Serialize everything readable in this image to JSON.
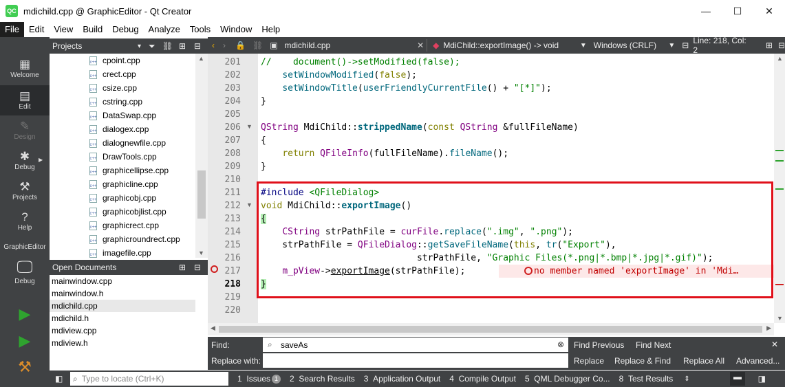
{
  "window": {
    "title": "mdichild.cpp @ GraphicEditor - Qt Creator",
    "app_icon": "QC",
    "minimize": "—",
    "maximize": "☐",
    "close": "✕"
  },
  "menu": [
    "File",
    "Edit",
    "View",
    "Build",
    "Debug",
    "Analyze",
    "Tools",
    "Window",
    "Help"
  ],
  "modes": {
    "welcome": "Welcome",
    "edit": "Edit",
    "design": "Design",
    "debug": "Debug",
    "projects": "Projects",
    "help": "Help",
    "project_name": "GraphicEditor",
    "kit_debug": "Debug"
  },
  "projects_panel": {
    "title": "Projects",
    "files": [
      "cpoint.cpp",
      "crect.cpp",
      "csize.cpp",
      "cstring.cpp",
      "DataSwap.cpp",
      "dialogex.cpp",
      "dialognewfile.cpp",
      "DrawTools.cpp",
      "graphicellipse.cpp",
      "graphicline.cpp",
      "graphicobj.cpp",
      "graphicobjlist.cpp",
      "graphicrect.cpp",
      "graphicroundrect.cpp",
      "imagefile.cpp"
    ]
  },
  "open_documents": {
    "title": "Open Documents",
    "files": [
      "mainwindow.cpp",
      "mainwindow.h",
      "mdichild.cpp",
      "mdichild.h",
      "mdiview.cpp",
      "mdiview.h"
    ],
    "selected": "mdichild.cpp"
  },
  "editor_toolbar": {
    "file": "mdichild.cpp",
    "function": "MdiChild::exportImage() -> void",
    "line_endings": "Windows (CRLF)",
    "position": "Line: 218, Col: 2"
  },
  "editor": {
    "line_numbers": [
      "201",
      "202",
      "203",
      "204",
      "205",
      "206",
      "207",
      "208",
      "209",
      "210",
      "211",
      "212",
      "213",
      "214",
      "215",
      "216",
      "217",
      "218",
      "219",
      "220"
    ],
    "lines": {
      "l201a": "//    ",
      "l201b": "document",
      "l201c": "()->",
      "l201d": "setModified",
      "l201e": "(",
      "l201f": "false",
      "l201g": ");",
      "l202a": "    ",
      "l202b": "setWindowModified",
      "l202c": "(",
      "l202d": "false",
      "l202e": ");",
      "l203a": "    ",
      "l203b": "setWindowTitle",
      "l203c": "(",
      "l203d": "userFriendlyCurrentFile",
      "l203e": "() + ",
      "l203f": "\"[*]\"",
      "l203g": ");",
      "l204": "}",
      "l206a": "QString",
      "l206b": " MdiChild::",
      "l206c": "strippedName",
      "l206d": "(",
      "l206e": "const",
      "l206f": " ",
      "l206g": "QString",
      "l206h": " &fullFileName)",
      "l207": "{",
      "l208a": "    ",
      "l208b": "return",
      "l208c": " ",
      "l208d": "QFileInfo",
      "l208e": "(fullFileName).",
      "l208f": "fileName",
      "l208g": "();",
      "l209": "}",
      "l211a": "#include",
      "l211b": " ",
      "l211c": "<QFileDialog>",
      "l212a": "void",
      "l212b": " MdiChild::",
      "l212c": "exportImage",
      "l212d": "()",
      "l213": "{",
      "l214a": "    ",
      "l214b": "CString",
      "l214c": " strPathFile = ",
      "l214d": "curFile",
      "l214e": ".",
      "l214f": "replace",
      "l214g": "(",
      "l214h": "\".img\"",
      "l214i": ", ",
      "l214j": "\".png\"",
      "l214k": ");",
      "l215a": "    strPathFile = ",
      "l215b": "QFileDialog",
      "l215c": "::",
      "l215d": "getSaveFileName",
      "l215e": "(",
      "l215f": "this",
      "l215g": ", ",
      "l215h": "tr",
      "l215i": "(",
      "l215j": "\"Export\"",
      "l215k": "),",
      "l216a": "                             strPathFile, ",
      "l216b": "\"Graphic Files(*.png|*.bmp|*.jpg|*.gif)\"",
      "l216c": ");",
      "l217a": "    ",
      "l217b": "m_pView",
      "l217c": "->",
      "l217d": "exportImage",
      "l217e": "(strPathFile);",
      "l217err": "no member named 'exportImage' in 'Mdi…",
      "l218": "}"
    }
  },
  "find_bar": {
    "find_label": "Find:",
    "replace_label": "Replace with:",
    "find_value": "saveAs",
    "replace_value": "",
    "find_previous": "Find Previous",
    "find_next": "Find Next",
    "replace": "Replace",
    "replace_find": "Replace & Find",
    "replace_all": "Replace All",
    "advanced": "Advanced..."
  },
  "status_bar": {
    "locate_placeholder": "Type to locate (Ctrl+K)",
    "panes": [
      {
        "num": "1",
        "label": "Issues",
        "badge": "1"
      },
      {
        "num": "2",
        "label": "Search Results"
      },
      {
        "num": "3",
        "label": "Application Output"
      },
      {
        "num": "4",
        "label": "Compile Output"
      },
      {
        "num": "5",
        "label": "QML Debugger Co..."
      },
      {
        "num": "8",
        "label": "Test Results"
      }
    ]
  },
  "colors": {
    "accent_red": "#e0101a",
    "side_bar": "#404244",
    "run_green": "#2fa32f"
  }
}
